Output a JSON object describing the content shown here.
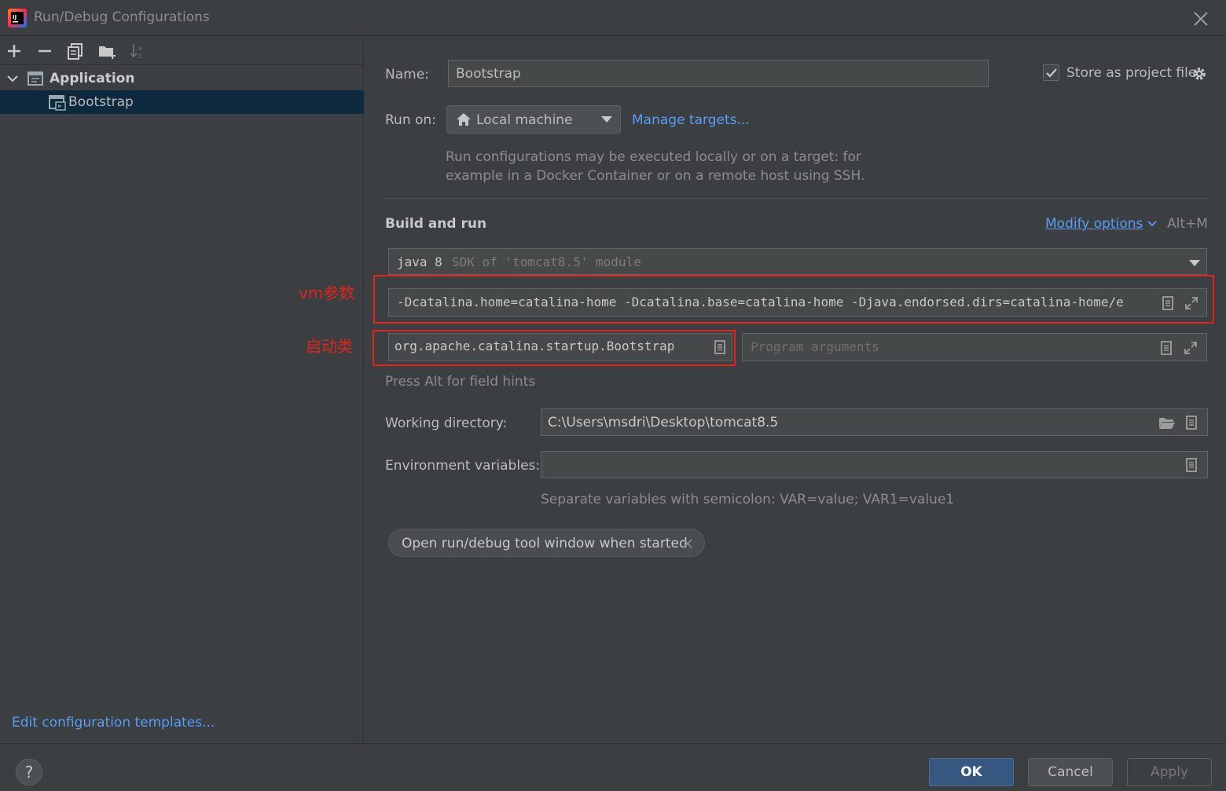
{
  "window": {
    "title": "Run/Debug Configurations"
  },
  "left": {
    "tree": [
      {
        "label": "Application",
        "type": "group"
      },
      {
        "label": "Bootstrap",
        "type": "item",
        "selected": true
      }
    ],
    "edit_templates": "Edit configuration templates..."
  },
  "form": {
    "name_label": "Name:",
    "name_value": "Bootstrap",
    "store_label": "Store as project file",
    "store_checked": true,
    "runon_label": "Run on:",
    "runon_value": "Local machine",
    "manage_targets": "Manage targets...",
    "runon_hint_line1": "Run configurations may be executed locally or on a target: for",
    "runon_hint_line2": "example in a Docker Container or on a remote host using SSH.",
    "build_run_title": "Build and run",
    "modify_options": "Modify options",
    "modify_shortcut": "Alt+M",
    "sdk_java": "java 8",
    "sdk_rest": "SDK of 'tomcat8.5' module",
    "vm_options": "-Dcatalina.home=catalina-home -Dcatalina.base=catalina-home -Djava.endorsed.dirs=catalina-home/e",
    "main_class": "org.apache.catalina.startup.Bootstrap",
    "program_args_placeholder": "Program arguments",
    "field_hints": "Press Alt for field hints",
    "workdir_label": "Working directory:",
    "workdir_value": "C:\\Users\\msdri\\Desktop\\tomcat8.5",
    "env_label": "Environment variables:",
    "env_value": "",
    "env_hint": "Separate variables with semicolon: VAR=value; VAR1=value1",
    "open_tool_window_chip": "Open run/debug tool window when started"
  },
  "annotations": {
    "vm_params": "vm参数",
    "main_class": "启动类"
  },
  "buttons": {
    "help": "?",
    "ok": "OK",
    "cancel": "Cancel",
    "apply": "Apply"
  },
  "colors": {
    "accent_link": "#589df6",
    "selected_row": "#0d293e",
    "annotation_red": "#e0241c",
    "ok_button": "#365880"
  }
}
